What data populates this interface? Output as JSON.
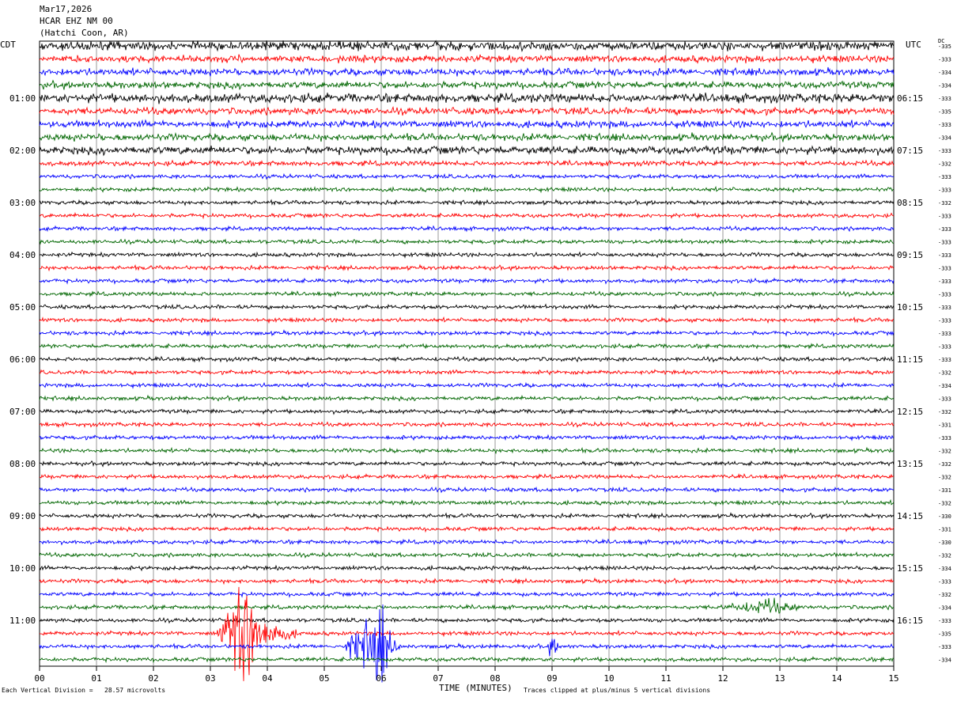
{
  "header": {
    "date": "Mar17,2026",
    "station": "HCAR EHZ NM 00",
    "location": "(Hatchi Coon, AR)"
  },
  "left_zone": "CDT",
  "right_zone": "UTC",
  "dc_label": "DC",
  "footer": {
    "scale_note": "Each Vertical Division =   28.57 microvolts",
    "xlabel": "TIME (MINUTES)",
    "clip_note": "Traces clipped at plus/minus 5 vertical divisions"
  },
  "colors": {
    "cycle": [
      "#000000",
      "#ff0000",
      "#0000ff",
      "#006600"
    ],
    "grid": "#808080"
  },
  "chart_data": {
    "type": "line",
    "subtype": "helicorder",
    "title": "HCAR EHZ NM 00",
    "xlabel": "TIME (MINUTES)",
    "ylabel": "",
    "xlim": [
      0,
      15
    ],
    "x_ticks": [
      "00",
      "01",
      "02",
      "03",
      "04",
      "05",
      "06",
      "07",
      "08",
      "09",
      "10",
      "11",
      "12",
      "13",
      "14",
      "15"
    ],
    "minutes_per_line": 15,
    "trace_count": 48,
    "left_hour_labels": [
      "01:00",
      "02:00",
      "03:00",
      "04:00",
      "05:00",
      "06:00",
      "07:00",
      "08:00",
      "09:00",
      "10:00",
      "11:00"
    ],
    "right_hour_labels": [
      "06:15",
      "07:15",
      "08:15",
      "09:15",
      "10:15",
      "11:15",
      "12:15",
      "13:15",
      "14:15",
      "15:15",
      "16:15"
    ],
    "dc_offsets": [
      -335,
      -333,
      -334,
      -334,
      -333,
      -335,
      -333,
      -334,
      -333,
      -332,
      -333,
      -333,
      -332,
      -333,
      -333,
      -333,
      -333,
      -333,
      -333,
      -333,
      -333,
      -333,
      -333,
      -333,
      -333,
      -332,
      -334,
      -333,
      -332,
      -331,
      -333,
      -332,
      -332,
      -332,
      -331,
      -332,
      -330,
      -331,
      -330,
      -332,
      -334,
      -333,
      -332,
      -334,
      -333,
      -335,
      -333,
      -334
    ],
    "noise_levels": [
      4.5,
      3.5,
      3.5,
      3.5,
      4.5,
      3.5,
      3.5,
      3.5,
      4,
      2.5,
      2,
      2,
      2,
      2,
      2,
      2,
      2,
      2,
      2,
      2,
      2,
      2,
      2,
      2,
      2,
      2,
      2,
      2,
      2,
      2,
      2,
      2,
      2,
      2,
      2,
      2,
      2,
      2,
      2,
      2,
      2,
      2,
      2,
      2,
      2,
      2,
      2,
      2
    ],
    "events": [
      {
        "trace": 45,
        "start_min": 3.1,
        "peak_min": 3.6,
        "end_min": 4.6,
        "amplitude": 60
      },
      {
        "trace": 46,
        "start_min": 5.3,
        "peak_min": 6.0,
        "end_min": 6.4,
        "amplitude": 45
      },
      {
        "trace": 46,
        "start_min": 8.9,
        "peak_min": 9.0,
        "end_min": 9.3,
        "amplitude": 14
      },
      {
        "trace": 43,
        "start_min": 11.6,
        "peak_min": 12.9,
        "end_min": 14.1,
        "amplitude": 9
      },
      {
        "trace": 1,
        "start_min": 10.1,
        "peak_min": 10.5,
        "end_min": 11.0,
        "amplitude": 5
      }
    ],
    "scale": "Each Vertical Division =   28.57 microvolts",
    "clip": "Traces clipped at plus/minus 5 vertical divisions"
  }
}
